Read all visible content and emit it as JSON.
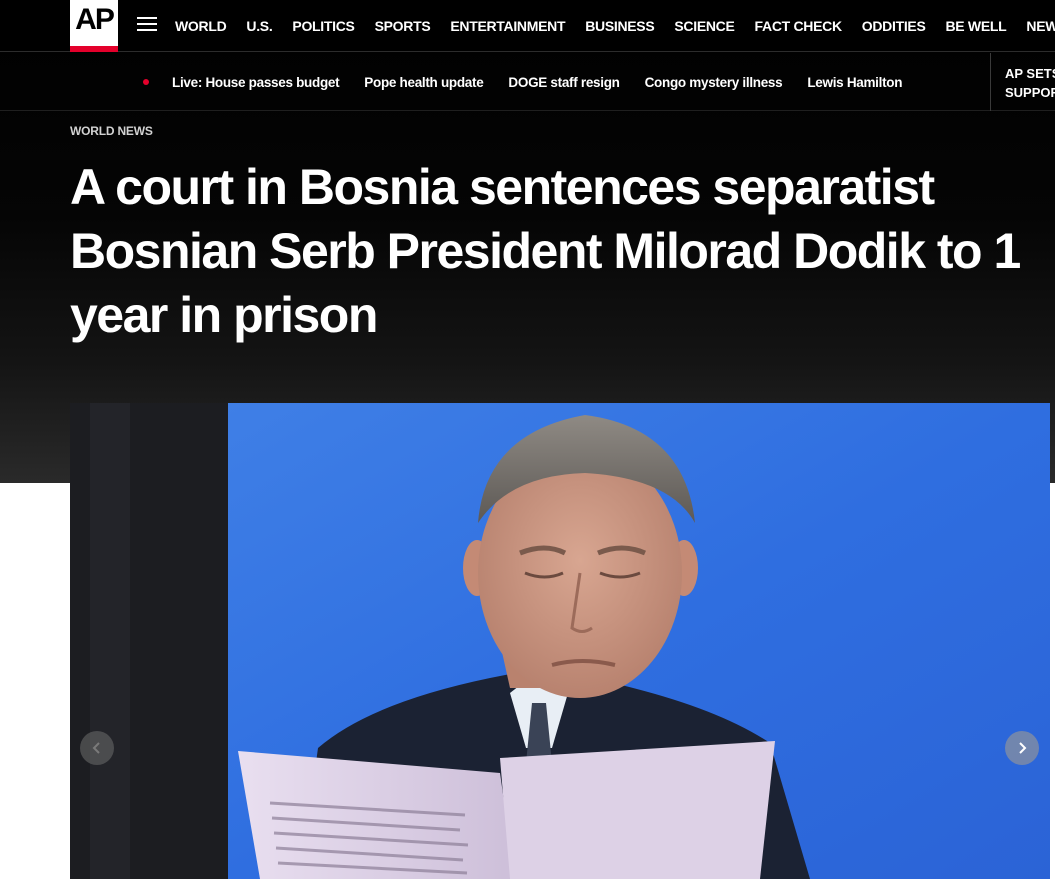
{
  "header": {
    "logo_text": "AP",
    "nav": [
      "WORLD",
      "U.S.",
      "POLITICS",
      "SPORTS",
      "ENTERTAINMENT",
      "BUSINESS",
      "SCIENCE",
      "FACT CHECK",
      "ODDITIES",
      "BE WELL",
      "NEWSLETTERS"
    ]
  },
  "trending": {
    "items": [
      "Live: House passes budget",
      "Pope health update",
      "DOGE staff resign",
      "Congo mystery illness",
      "Lewis Hamilton"
    ],
    "promo_line1": "AP SETS",
    "promo_line2": "SUPPORT"
  },
  "article": {
    "section": "WORLD NEWS",
    "headline": "A court in Bosnia sentences separatist Bosnian Serb President Milorad Dodik to 1 year in prison"
  },
  "icons": {
    "menu": "hamburger-icon",
    "prev": "chevron-left-icon",
    "next": "chevron-right-icon",
    "live": "live-dot-icon"
  },
  "colors": {
    "accent": "#e4002b",
    "background": "#000000",
    "text": "#ffffff"
  }
}
